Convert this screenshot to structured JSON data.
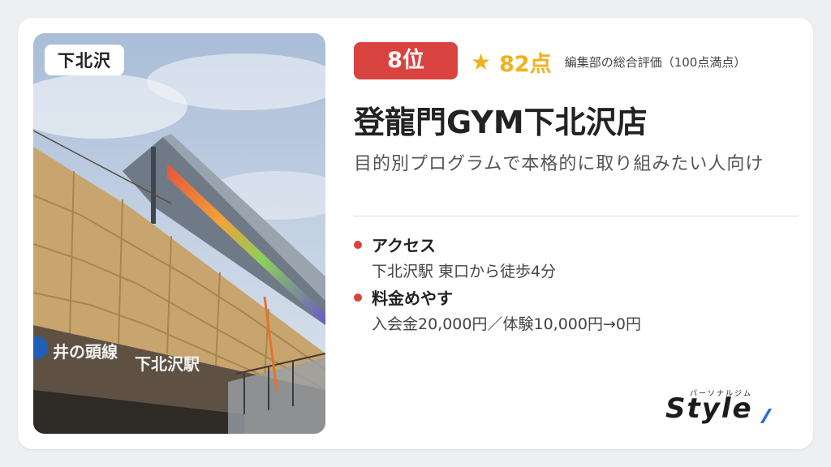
{
  "card": {
    "area_badge": "下北沢",
    "rank": "8位",
    "score": "82点",
    "score_note": "編集部の総合評価（100点満点）",
    "title": "登龍門GYM下北沢店",
    "subtitle": "目的別プログラムで本格的に取り組みたい人向け",
    "features": [
      {
        "label": "アクセス",
        "value": "下北沢駅 東口から徒歩4分"
      },
      {
        "label": "料金めやす",
        "value": "入会金20,000円／体験10,000円→0円"
      }
    ],
    "logo": {
      "kana": "パーソナルジム",
      "word": "Style"
    },
    "photo_signs": {
      "sign1": "井の頭線",
      "sign2": "下北沢駅"
    }
  },
  "colors": {
    "accent_red": "#d9433f",
    "star_yellow": "#f0b21c",
    "logo_blue": "#2a6fd6"
  }
}
